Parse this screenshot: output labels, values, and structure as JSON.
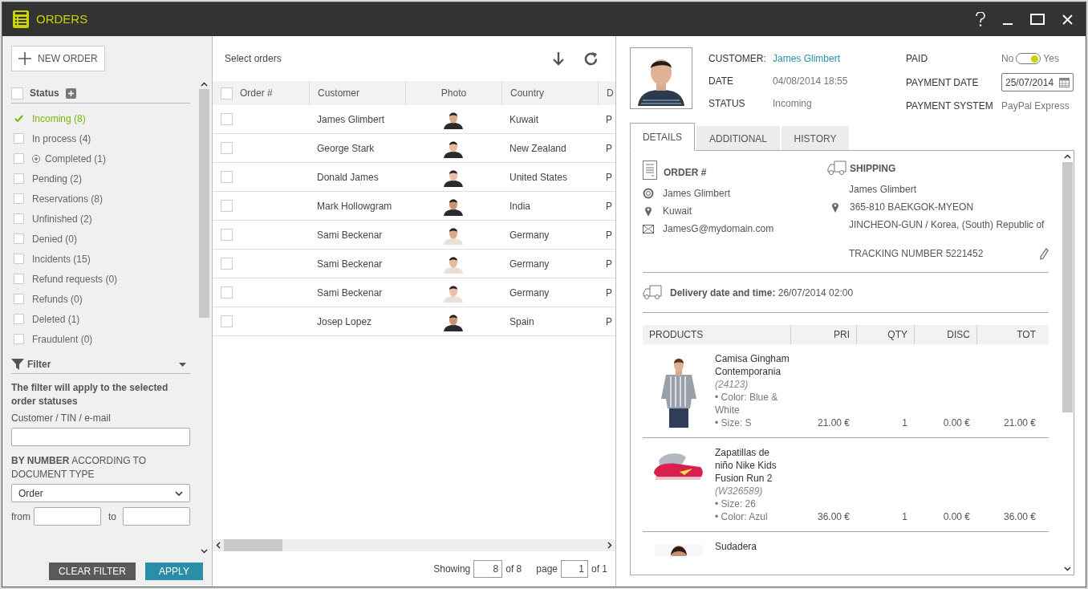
{
  "window": {
    "title": "ORDERS"
  },
  "sidebar": {
    "new_order_label": "NEW ORDER",
    "status_header": {
      "label": "Status",
      "checked": false
    },
    "statuses": [
      {
        "label": "Incoming (8)",
        "checked": true,
        "expandable": false
      },
      {
        "label": "In process (4)",
        "checked": false,
        "expandable": false
      },
      {
        "label": "Completed (1)",
        "checked": false,
        "expandable": true
      },
      {
        "label": "Pending (2)",
        "checked": false,
        "expandable": false
      },
      {
        "label": "Reservations (8)",
        "checked": false,
        "expandable": false
      },
      {
        "label": "Unfinished (2)",
        "checked": false,
        "expandable": false
      },
      {
        "label": "Denied (0)",
        "checked": false,
        "expandable": false
      },
      {
        "label": "Incidents (15)",
        "checked": false,
        "expandable": false
      },
      {
        "label": "Refund requests (0)",
        "checked": false,
        "expandable": false
      },
      {
        "label": "Refunds (0)",
        "checked": false,
        "expandable": false
      },
      {
        "label": "Deleted (1)",
        "checked": false,
        "expandable": false
      },
      {
        "label": "Fraudulent (0)",
        "checked": false,
        "expandable": false
      }
    ],
    "filter": {
      "title": "Filter",
      "note": "The filter will apply to the selected order statuses",
      "customer_label": "Customer / TIN / e-mail",
      "number_label": "**BY NUMBER** ACCORDING TO DOCUMENT TYPE",
      "document_type": "Order",
      "from_label": "from",
      "to_label": "to"
    },
    "buttons": {
      "clear": "CLEAR FILTER",
      "apply": "APPLY"
    }
  },
  "orders": {
    "title": "Select orders",
    "select_all": {
      "checked": false
    },
    "columns": [
      "Order #",
      "Customer",
      "Photo",
      "Country",
      "D"
    ],
    "rows": [
      {
        "customer": "James Glimbert",
        "country": "Kuwait",
        "column_5": "P",
        "selected": false
      },
      {
        "customer": "George Stark",
        "country": "New Zealand",
        "column_5": "P",
        "selected": false
      },
      {
        "customer": "Donald James",
        "country": "United States",
        "column_5": "P",
        "selected": false
      },
      {
        "customer": "Mark Hollowgram",
        "country": "India",
        "column_5": "P",
        "selected": false
      },
      {
        "customer": "Sami Beckenar",
        "country": "Germany",
        "column_5": "P",
        "selected": false
      },
      {
        "customer": "Sami Beckenar",
        "country": "Germany",
        "column_5": "P",
        "selected": false
      },
      {
        "customer": "Sami Beckenar",
        "country": "Germany",
        "column_5": "P",
        "selected": false
      },
      {
        "customer": "Josep Lopez",
        "country": "Spain",
        "column_5": "P",
        "selected": false
      }
    ],
    "pagination": {
      "showing_label": "Showing",
      "showing_value": "8",
      "showing_total": "of 8",
      "page_label": "page",
      "page_value": "1",
      "page_total": "of 1"
    }
  },
  "detail": {
    "fields": [
      {
        "label": "CUSTOMER:",
        "value": "James Glimbert",
        "kind": "link"
      },
      {
        "label": "DATE",
        "value": "04/08/2014 18:55",
        "kind": "text"
      },
      {
        "label": "STATUS",
        "value": "Incoming",
        "kind": "text"
      }
    ],
    "paid": {
      "label": "PAID",
      "off_label": "No",
      "on_label": "Yes",
      "on": true
    },
    "payment_date": {
      "label": "PAYMENT DATE",
      "value": "25/07/2014"
    },
    "payment_system": {
      "label": "PAYMENT SYSTEM",
      "value": "PayPal Express"
    },
    "tabs": [
      {
        "label": "DETAILS",
        "selected": true
      },
      {
        "label": "ADDITIONAL",
        "selected": false
      },
      {
        "label": "HISTORY",
        "selected": false
      }
    ],
    "order": {
      "title": "ORDER #",
      "customer": "James Glimbert",
      "country": "Kuwait",
      "email": "JamesG@mydomain.com"
    },
    "shipping": {
      "title": "SHIPPING",
      "name": "James Glimbert",
      "address_1": "365-810 BAEKGOK-MYEON",
      "address_2": "JINCHEON-GUN / Korea, (South) Republic of",
      "tracking": "TRACKING NUMBER 5221452"
    },
    "delivery": {
      "label": "Delivery date and time:",
      "value": "26/07/2014 02:00"
    },
    "products": {
      "columns": [
        "PRODUCTS",
        "PRI",
        "QTY",
        "DISC",
        "TOT"
      ],
      "items": [
        {
          "name": "Camisa Gingham Contemporania",
          "code": "(24123)",
          "options": [
            "• Color: Blue & White",
            "• Size: S"
          ],
          "price": "21.00 €",
          "qty": "1",
          "discount": "0.00 €",
          "total": "21.00 €"
        },
        {
          "name": "Zapatillas de niño Nike Kids Fusion Run 2",
          "code": "(W326589)",
          "options": [
            "• Size: 26",
            "• Color: Azul"
          ],
          "price": "36.00 €",
          "qty": "1",
          "discount": "0.00 €",
          "total": "36.00 €"
        },
        {
          "name": "Sudadera"
        }
      ]
    }
  }
}
